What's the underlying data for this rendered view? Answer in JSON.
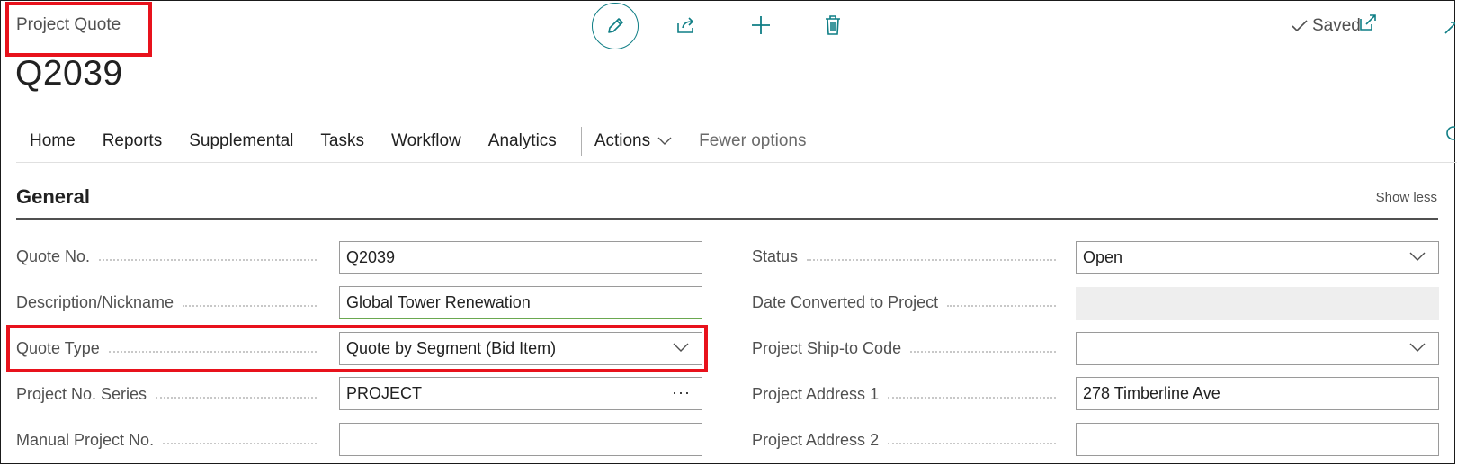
{
  "header": {
    "page_caption": "Project Quote",
    "record_title": "Q2039",
    "saved_label": "Saved"
  },
  "tabs": [
    {
      "label": "Home"
    },
    {
      "label": "Reports"
    },
    {
      "label": "Supplemental"
    },
    {
      "label": "Tasks"
    },
    {
      "label": "Workflow"
    },
    {
      "label": "Analytics"
    },
    {
      "label": "Actions"
    },
    {
      "label": "Fewer options"
    }
  ],
  "section": {
    "title": "General",
    "toggle_label": "Show less"
  },
  "fields_left": [
    {
      "label": "Quote No.",
      "value": "Q2039"
    },
    {
      "label": "Description/Nickname",
      "value": "Global Tower Renewation"
    },
    {
      "label": "Quote Type",
      "value": "Quote by Segment (Bid Item)"
    },
    {
      "label": "Project No. Series",
      "value": "PROJECT"
    },
    {
      "label": "Manual Project No.",
      "value": ""
    }
  ],
  "fields_right": [
    {
      "label": "Status",
      "value": "Open"
    },
    {
      "label": "Date Converted to Project",
      "value": ""
    },
    {
      "label": "Project Ship-to Code",
      "value": ""
    },
    {
      "label": "Project Address 1",
      "value": "278 Timberline Ave"
    },
    {
      "label": "Project Address 2",
      "value": ""
    }
  ],
  "colors": {
    "accent": "#0f7e85",
    "highlight": "#e8121c"
  }
}
